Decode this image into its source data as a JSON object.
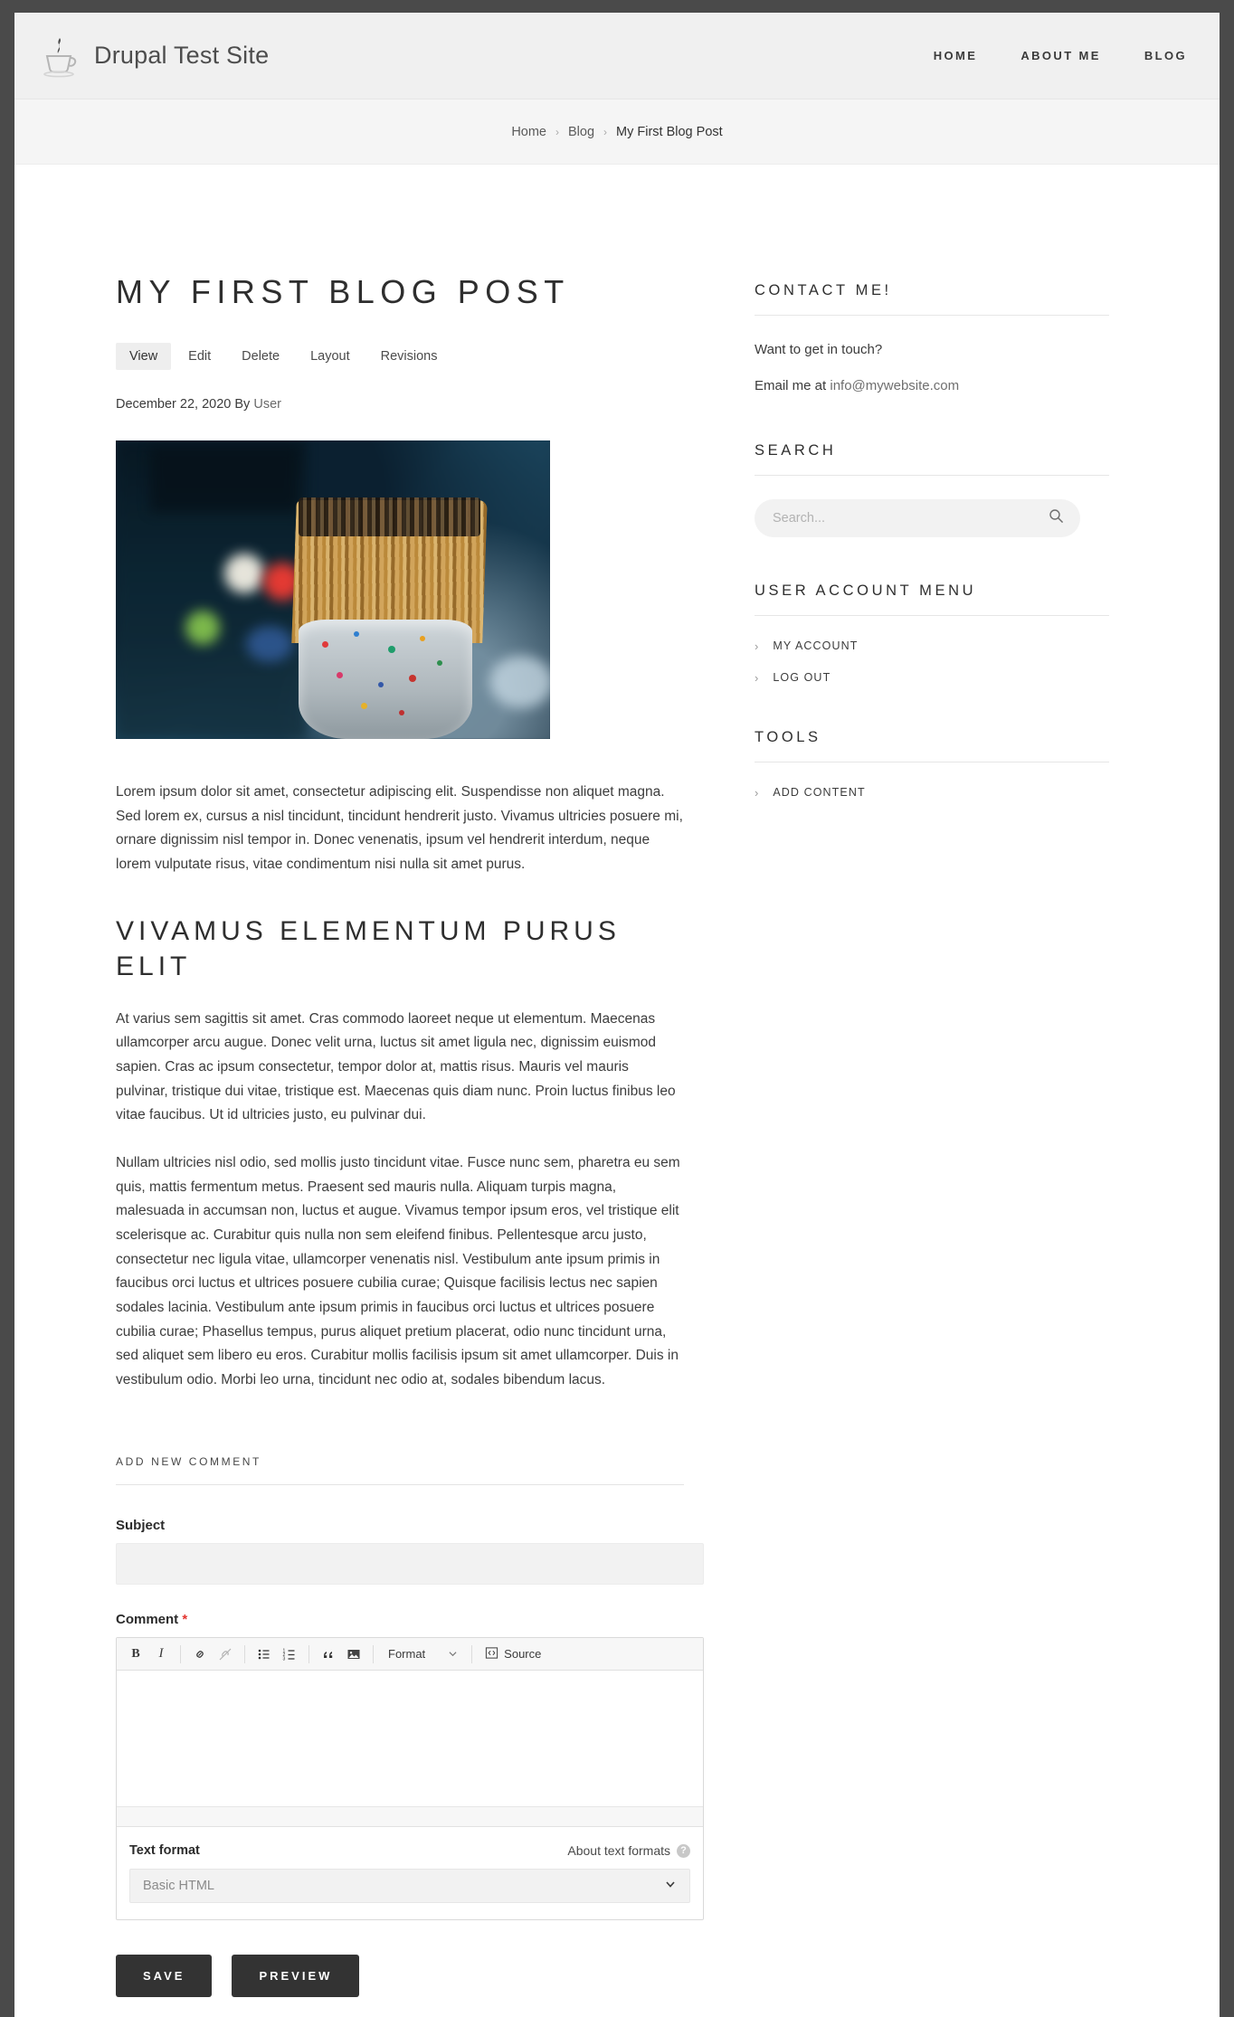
{
  "header": {
    "site_name": "Drupal Test Site",
    "logo_icon": "coffee-cup-icon",
    "nav": [
      {
        "label": "HOME"
      },
      {
        "label": "ABOUT ME"
      },
      {
        "label": "BLOG"
      }
    ]
  },
  "breadcrumb": {
    "items": [
      {
        "label": "Home"
      },
      {
        "label": "Blog"
      },
      {
        "label": "My First Blog Post"
      }
    ],
    "separator": "›"
  },
  "article": {
    "title": "My First Blog Post",
    "tabs": [
      {
        "label": "View",
        "active": true
      },
      {
        "label": "Edit",
        "active": false
      },
      {
        "label": "Delete",
        "active": false
      },
      {
        "label": "Layout",
        "active": false
      },
      {
        "label": "Revisions",
        "active": false
      }
    ],
    "byline_date": "December 22, 2020 By",
    "byline_author": "User",
    "image_alt": "Paintbrushes in a paint-splattered jar with bokeh lights",
    "paragraph_1": "Lorem ipsum dolor sit amet, consectetur adipiscing elit. Suspendisse non aliquet magna. Sed lorem ex, cursus a nisl tincidunt, tincidunt hendrerit justo. Vivamus ultricies posuere mi, ornare dignissim nisl tempor in. Donec venenatis, ipsum vel hendrerit interdum, neque lorem vulputate risus, vitae condimentum nisi nulla sit amet purus.",
    "heading_2": "Vivamus elementum purus elit",
    "paragraph_2": "At varius sem sagittis sit amet. Cras commodo laoreet neque ut elementum. Maecenas ullamcorper arcu augue. Donec velit urna, luctus sit amet ligula nec, dignissim euismod sapien. Cras ac ipsum consectetur, tempor dolor at, mattis risus. Mauris vel mauris pulvinar, tristique dui vitae, tristique est. Maecenas quis diam nunc. Proin luctus finibus leo vitae faucibus. Ut id ultricies justo, eu pulvinar dui.",
    "paragraph_3": "Nullam ultricies nisl odio, sed mollis justo tincidunt vitae. Fusce nunc sem, pharetra eu sem quis, mattis fermentum metus. Praesent sed mauris nulla. Aliquam turpis magna, malesuada in accumsan non, luctus et augue. Vivamus tempor ipsum eros, vel tristique elit scelerisque ac. Curabitur quis nulla non sem eleifend finibus. Pellentesque arcu justo, consectetur nec ligula vitae, ullamcorper venenatis nisl. Vestibulum ante ipsum primis in faucibus orci luctus et ultrices posuere cubilia curae; Quisque facilisis lectus nec sapien sodales lacinia. Vestibulum ante ipsum primis in faucibus orci luctus et ultrices posuere cubilia curae; Phasellus tempus, purus aliquet pretium placerat, odio nunc tincidunt urna, sed aliquet sem libero eu eros. Curabitur mollis facilisis ipsum sit amet ullamcorper. Duis in vestibulum odio. Morbi leo urna, tincidunt nec odio at, sodales bibendum lacus."
  },
  "comment_form": {
    "heading": "Add new comment",
    "subject_label": "Subject",
    "subject_value": "",
    "comment_label": "Comment",
    "required_marker": "*",
    "comment_value": "",
    "toolbar": [
      {
        "name": "bold-icon",
        "glyph": "B",
        "disabled": false
      },
      {
        "name": "italic-icon",
        "glyph": "I",
        "disabled": false
      },
      {
        "name": "link-icon",
        "glyph": "⚭",
        "disabled": false
      },
      {
        "name": "unlink-icon",
        "glyph": "⚭",
        "disabled": true
      },
      {
        "name": "bulleted-list-icon",
        "glyph": "≡",
        "disabled": false
      },
      {
        "name": "numbered-list-icon",
        "glyph": "≡",
        "disabled": false
      },
      {
        "name": "blockquote-icon",
        "glyph": "”",
        "disabled": false
      },
      {
        "name": "image-icon",
        "glyph": "▣",
        "disabled": false
      }
    ],
    "format_dropdown_label": "Format",
    "source_button_label": "Source",
    "text_format_label": "Text format",
    "about_text_formats_label": "About text formats",
    "help_icon_glyph": "?",
    "text_format_value": "Basic HTML",
    "save_label": "SAVE",
    "preview_label": "PREVIEW"
  },
  "sidebar": {
    "contact": {
      "title": "Contact me!",
      "line_1": "Want to get in touch?",
      "line_2_prefix": "Email me at ",
      "email": "info@mywebsite.com"
    },
    "search": {
      "title": "Search",
      "placeholder": "Search...",
      "value": "",
      "icon": "search-icon"
    },
    "user_account_menu": {
      "title": "User account menu",
      "items": [
        {
          "label": "My account"
        },
        {
          "label": "Log out"
        }
      ]
    },
    "tools": {
      "title": "Tools",
      "items": [
        {
          "label": "Add content"
        }
      ]
    },
    "chevron": "›"
  },
  "colors": {
    "page_bg": "#ffffff",
    "frame": "#4a4a4a",
    "header_bg": "#f0f0f0",
    "button_dark": "#333333",
    "required_red": "#e3342f"
  }
}
